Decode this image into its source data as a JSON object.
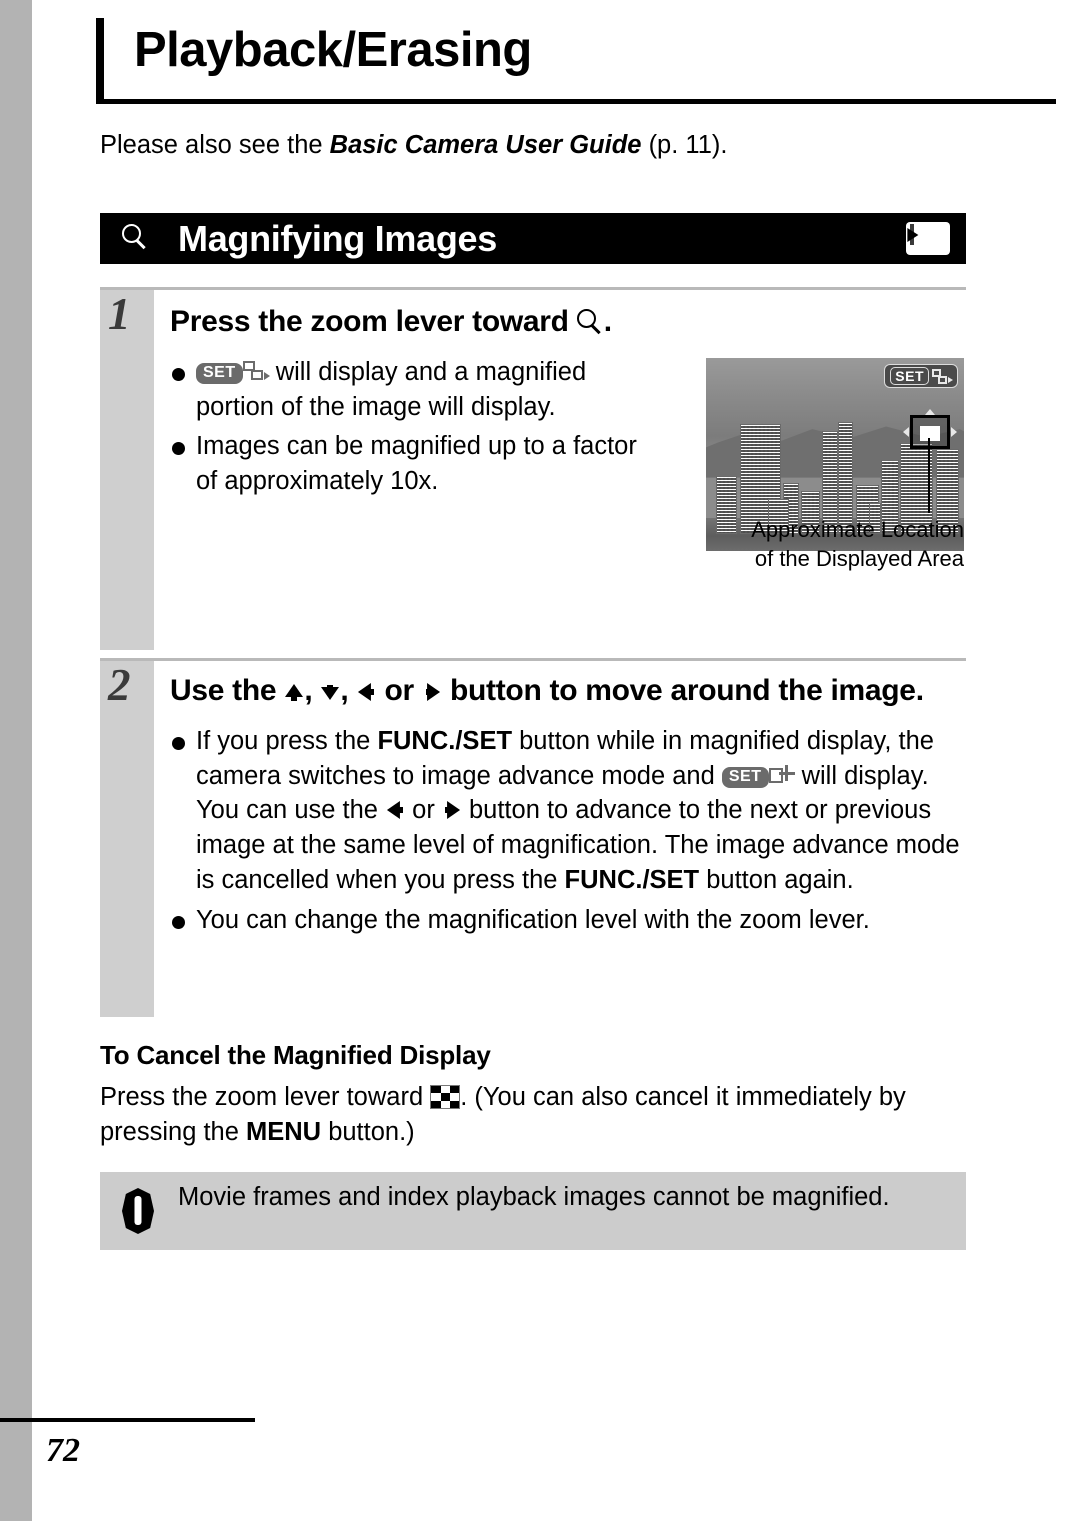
{
  "page": {
    "chapter_title": "Playback/Erasing",
    "intro_prefix": "Please also see the ",
    "intro_book": "Basic Camera User Guide",
    "intro_suffix": " (p. 11).",
    "page_number": "72"
  },
  "section": {
    "title": "Magnifying Images",
    "icon": "magnifier-icon",
    "mode_badge_icon": "playback-mode-icon"
  },
  "steps": [
    {
      "number": "1",
      "heading_prefix": "Press the zoom lever toward ",
      "heading_icon": "magnifier-icon",
      "heading_suffix": ".",
      "bullets": [
        {
          "icon_set_label": "SET",
          "icon_second": "image-advance-swap-icon",
          "text": " will display and a magnified portion of the image will display."
        },
        {
          "text": "Images can be magnified up to a factor of approximately 10x."
        }
      ]
    },
    {
      "number": "2",
      "heading_part1": "Use the ",
      "heading_part2": ", ",
      "heading_part3": ", ",
      "heading_part4": " or ",
      "heading_part5": " button to move around the image.",
      "bullets": [
        {
          "t1": "If you press the ",
          "b1": "FUNC./SET",
          "t2": " button while in magnified display, the camera switches to image advance mode and ",
          "icon_set_label": "SET",
          "icon_second": "pan-move-icon",
          "t3": " will display. You can use the ",
          "t4": " or ",
          "t5": " button to advance to the next or previous image at the same level of magnification. The image advance mode is cancelled when you press the ",
          "b2": "FUNC./SET",
          "t6": " button again."
        },
        {
          "text": "You can change the magnification level with the zoom lever."
        }
      ]
    }
  ],
  "figure": {
    "alt": "grayscale city skyline photo",
    "overlay_set_label": "SET",
    "overlay_second_icon": "image-advance-swap-icon",
    "caption_line1": "Approximate Location",
    "caption_line2": "of the Displayed Area"
  },
  "cancel_section": {
    "heading": "To Cancel the Magnified Display",
    "text_before_icon": "Press the zoom lever toward ",
    "icon": "index-playback-icon",
    "text_after_icon": ". (You can also cancel it immediately by pressing the ",
    "bold_word": "MENU",
    "text_end": " button.)"
  },
  "note": {
    "icon": "warning-exclamation-icon",
    "text": "Movie frames and index playback images cannot be magnified."
  },
  "colors": {
    "spine_gray": "#b3b3b3",
    "banner_black": "#000000",
    "step_number_gray": "#cfcfcf",
    "note_gray": "#cccccc",
    "badge_gray": "#6b6b6b"
  }
}
